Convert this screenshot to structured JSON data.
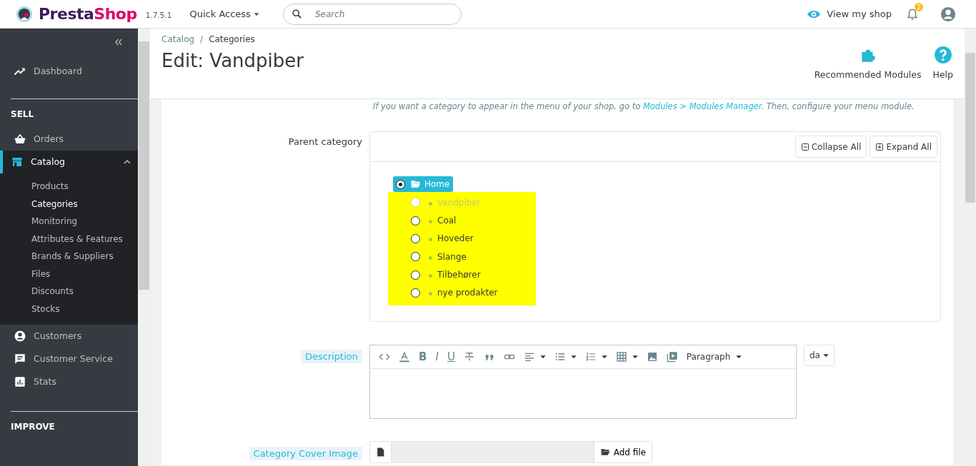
{
  "header": {
    "brand_parts": [
      {
        "text": "Presta",
        "color": "#3c1e5d"
      },
      {
        "text": "Shop",
        "color": "#df0067"
      }
    ],
    "version": "1.7.5.1",
    "quick_access": "Quick Access",
    "search": {
      "placeholder": "Search"
    },
    "view_shop": "View my shop",
    "notifications": "2"
  },
  "sidebar": {
    "items": [
      {
        "kind": "item",
        "label": "Dashboard",
        "selected": false
      },
      {
        "kind": "section",
        "label": "SELL"
      },
      {
        "kind": "item",
        "label": "Orders",
        "selected": false
      },
      {
        "kind": "item",
        "label": "Catalog",
        "selected": true,
        "expanded": true,
        "children": [
          {
            "label": "Products",
            "selected": false
          },
          {
            "label": "Categories",
            "selected": true
          },
          {
            "label": "Monitoring",
            "selected": false
          },
          {
            "label": "Attributes & Features",
            "selected": false
          },
          {
            "label": "Brands & Suppliers",
            "selected": false
          },
          {
            "label": "Files",
            "selected": false
          },
          {
            "label": "Discounts",
            "selected": false
          },
          {
            "label": "Stocks",
            "selected": false
          }
        ]
      },
      {
        "kind": "item",
        "label": "Customers",
        "selected": false
      },
      {
        "kind": "item",
        "label": "Customer Service",
        "selected": false
      },
      {
        "kind": "item",
        "label": "Stats",
        "selected": false
      },
      {
        "kind": "section",
        "label": "IMPROVE"
      }
    ]
  },
  "page_header": {
    "breadcrumb": [
      "Catalog",
      "Categories"
    ],
    "breadcrumb_separator": "/",
    "title": "Edit: Vandpiber",
    "toolbar": [
      {
        "label": "Recommended Modules"
      },
      {
        "label": "Help"
      }
    ]
  },
  "form": {
    "hint": {
      "before": "If you want a category to appear in the menu of your shop, go to ",
      "link": "Modules > Modules Manager",
      "after": ". Then, configure your menu module."
    },
    "parent_category": {
      "label": "Parent category",
      "buttons": [
        {
          "label": "Collapse All"
        },
        {
          "label": "Expand All"
        }
      ],
      "tree": {
        "label": "Home",
        "selected": true,
        "children_highlighted": true,
        "children": [
          {
            "label": "Vandpiber",
            "selected": false,
            "disabled": true
          },
          {
            "label": "Coal",
            "selected": false,
            "disabled": false
          },
          {
            "label": "Hoveder",
            "selected": false,
            "disabled": false
          },
          {
            "label": "Slange",
            "selected": false,
            "disabled": false
          },
          {
            "label": "Tilbehører",
            "selected": false,
            "disabled": false
          },
          {
            "label": "nye prodakter",
            "selected": false,
            "disabled": false
          }
        ]
      }
    },
    "description": {
      "label": "Description",
      "toolbar": [
        {
          "kind": "code"
        },
        {
          "kind": "font-color"
        },
        {
          "kind": "bold",
          "glyph": "B"
        },
        {
          "kind": "italic",
          "glyph": "I"
        },
        {
          "kind": "underline",
          "glyph": "U"
        },
        {
          "kind": "strike"
        },
        {
          "kind": "quote"
        },
        {
          "kind": "link"
        },
        {
          "kind": "align",
          "caret": true
        },
        {
          "kind": "bullets",
          "caret": true
        },
        {
          "kind": "numbers",
          "caret": true
        },
        {
          "kind": "table",
          "caret": true
        },
        {
          "kind": "image"
        },
        {
          "kind": "media"
        }
      ],
      "format": "Paragraph",
      "language": "da"
    },
    "cover_image": {
      "label": "Category Cover Image",
      "button": "Add file"
    }
  }
}
